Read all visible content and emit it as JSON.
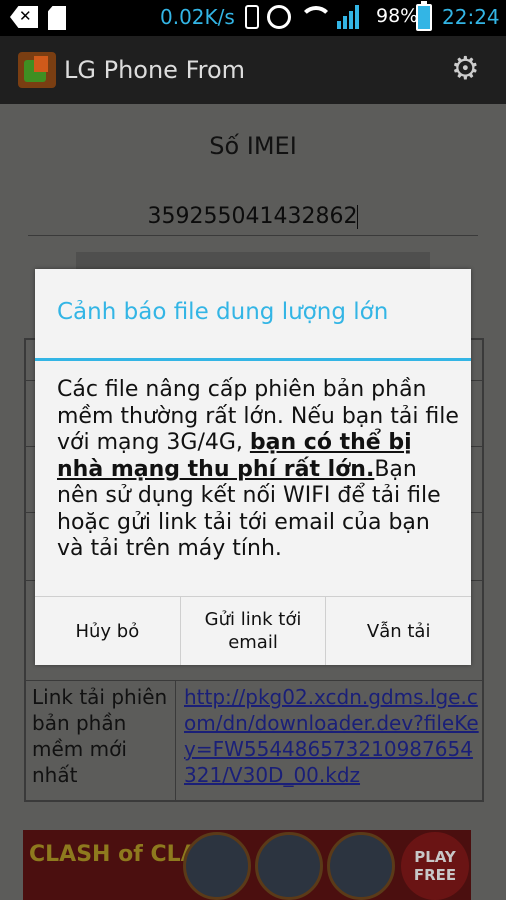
{
  "status_bar": {
    "net_speed": "0.02K/s",
    "battery": "98%",
    "time": "22:24",
    "icons": [
      "back-x-icon",
      "sd-card-icon",
      "vibrate-icon",
      "alarm-icon",
      "wifi-icon",
      "signal-icon",
      "battery-icon"
    ]
  },
  "action_bar": {
    "title": "LG Phone From",
    "settings_icon": "gear-icon"
  },
  "page": {
    "imei_label": "Số IMEI",
    "imei_value": "359255041432862",
    "link_row": {
      "label": "Link tải phiên bản phần mềm mới nhất",
      "url": "http://pkg02.xcdn.gdms.lge.com/dn/downloader.dev?fileKey=FW554486573210987654321/V30D_00.kdz"
    },
    "ad": {
      "logo_text": "CLASH of CLANS",
      "play_text": "PLAY FREE"
    }
  },
  "dialog": {
    "title": "Cảnh báo file dung lượng lớn",
    "body_prefix": "Các file nâng cấp phiên bản phần mềm thường rất lớn. Nếu bạn tải file với mạng 3G/4G, ",
    "body_bold": "bạn có thể bị nhà mạng thu phí rất lớn.",
    "body_suffix": "Bạn nên sử dụng kết nối WIFI để tải file hoặc gửi link tải tới email của bạn và tải trên máy tính.",
    "buttons": {
      "cancel": "Hủy bỏ",
      "email": "Gửi link tới email",
      "download": "Vẫn tải"
    }
  },
  "colors": {
    "accent": "#33b5e5",
    "link": "#1a1f78"
  }
}
